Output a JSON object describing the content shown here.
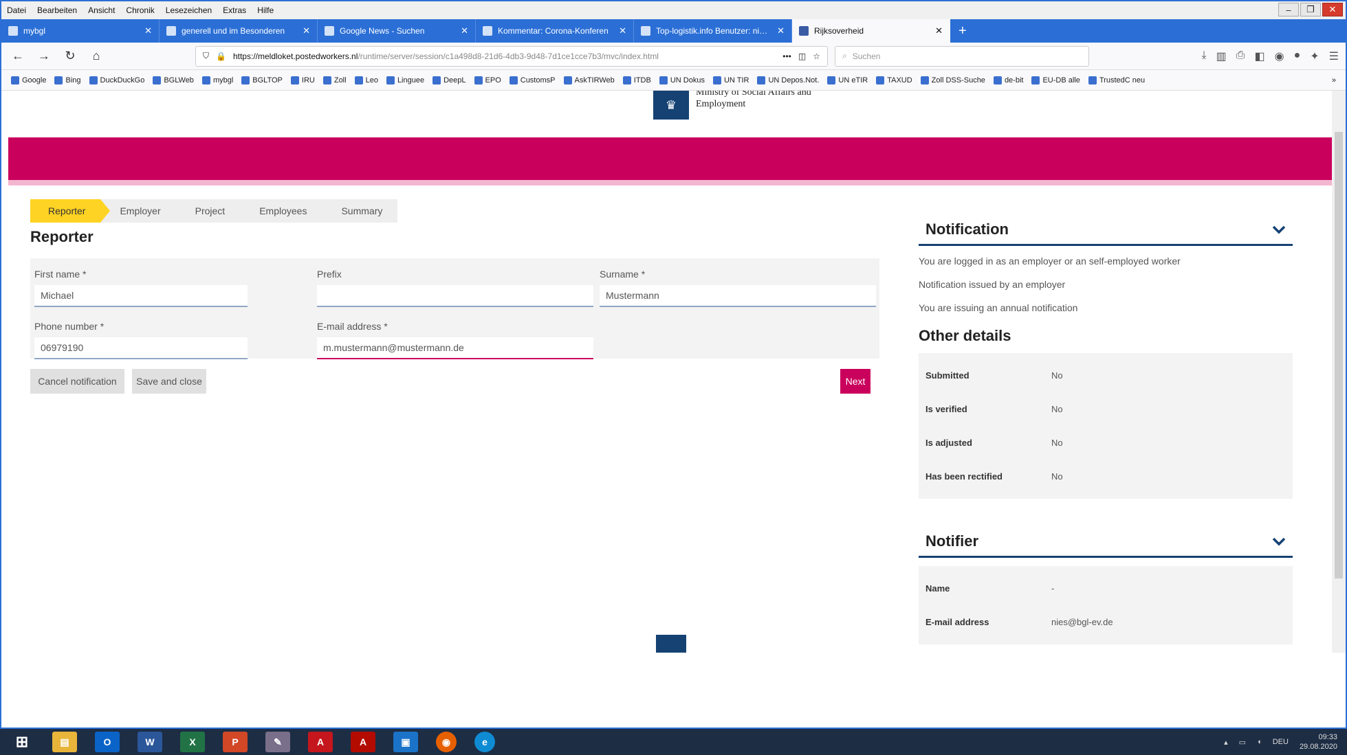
{
  "browser": {
    "menu": [
      "Datei",
      "Bearbeiten",
      "Ansicht",
      "Chronik",
      "Lesezeichen",
      "Extras",
      "Hilfe"
    ],
    "tabs": [
      {
        "label": "mybgl",
        "active": false
      },
      {
        "label": "generell und im Besonderen",
        "active": false
      },
      {
        "label": "Google News - Suchen",
        "active": false
      },
      {
        "label": "Kommentar: Corona-Konferen",
        "active": false
      },
      {
        "label": "Top-logistik.info Benutzer: nies@",
        "active": false
      },
      {
        "label": "Rijksoverheid",
        "active": true
      }
    ],
    "url_host": "https://meldloket.postedworkers.nl",
    "url_path": "/runtime/server/session/c1a498d8-21d6-4db3-9d48-7d1ce1cce7b3/mvc/index.html",
    "search_placeholder": "Suchen",
    "bookmarks": [
      "Google",
      "Bing",
      "DuckDuckGo",
      "BGLWeb",
      "mybgl",
      "BGLTOP",
      "IRU",
      "Zoll",
      "Leo",
      "Linguee",
      "DeepL",
      "EPO",
      "CustomsP",
      "AskTIRWeb",
      "ITDB",
      "UN Dokus",
      "UN TIR",
      "UN Depos.Not.",
      "UN eTIR",
      "TAXUD",
      "Zoll DSS-Suche",
      "de-bit",
      "EU-DB alle",
      "TrustedC neu"
    ]
  },
  "header": {
    "ministry_line1": "Ministry of Social Affairs and",
    "ministry_line2": "Employment",
    "colors": {
      "banner": "#ca005d",
      "stripe": "#f4b6cf",
      "brand": "#154273",
      "step_active": "#ffd323"
    }
  },
  "steps": [
    {
      "label": "Reporter",
      "active": true
    },
    {
      "label": "Employer",
      "active": false
    },
    {
      "label": "Project",
      "active": false
    },
    {
      "label": "Employees",
      "active": false
    },
    {
      "label": "Summary",
      "active": false
    }
  ],
  "form": {
    "title": "Reporter",
    "first_name": {
      "label": "First name *",
      "value": "Michael"
    },
    "prefix": {
      "label": "Prefix",
      "value": ""
    },
    "surname": {
      "label": "Surname *",
      "value": "Mustermann"
    },
    "phone": {
      "label": "Phone number *",
      "value": "06979190"
    },
    "email": {
      "label": "E-mail address *",
      "value": "m.mustermann@mustermann.de"
    },
    "cancel_label": "Cancel notification",
    "save_label": "Save and close",
    "next_label": "Next"
  },
  "notification": {
    "title": "Notification",
    "lines": [
      "You are logged in as an employer or an self-employed worker",
      "Notification issued by an employer",
      "You are issuing an annual notification"
    ]
  },
  "other_details": {
    "title": "Other details",
    "rows": [
      {
        "key": "Submitted",
        "value": "No"
      },
      {
        "key": "Is verified",
        "value": "No"
      },
      {
        "key": "Is adjusted",
        "value": "No"
      },
      {
        "key": "Has been rectified",
        "value": "No"
      }
    ]
  },
  "notifier": {
    "title": "Notifier",
    "rows": [
      {
        "key": "Name",
        "value": "-"
      },
      {
        "key": "E-mail address",
        "value": "nies@bgl-ev.de"
      }
    ]
  },
  "taskbar": {
    "apps": [
      {
        "name": "windows-start-icon",
        "color": "#1d2d44"
      },
      {
        "name": "file-explorer-icon",
        "color": "#e8b43a"
      },
      {
        "name": "outlook-icon",
        "color": "#0a64c8"
      },
      {
        "name": "word-icon",
        "color": "#2b579a"
      },
      {
        "name": "excel-icon",
        "color": "#217346"
      },
      {
        "name": "powerpoint-icon",
        "color": "#d24726"
      },
      {
        "name": "tool-icon",
        "color": "#7a6f8a"
      },
      {
        "name": "acrobat-icon",
        "color": "#c4161c"
      },
      {
        "name": "acrobat-reader-icon",
        "color": "#b30b00"
      },
      {
        "name": "document-app-icon",
        "color": "#1a73c8"
      },
      {
        "name": "firefox-icon",
        "color": "#e66000"
      },
      {
        "name": "edge-icon",
        "color": "#0f8bd3"
      }
    ],
    "language": "DEU",
    "time": "09:33",
    "date": "29.08.2020"
  }
}
